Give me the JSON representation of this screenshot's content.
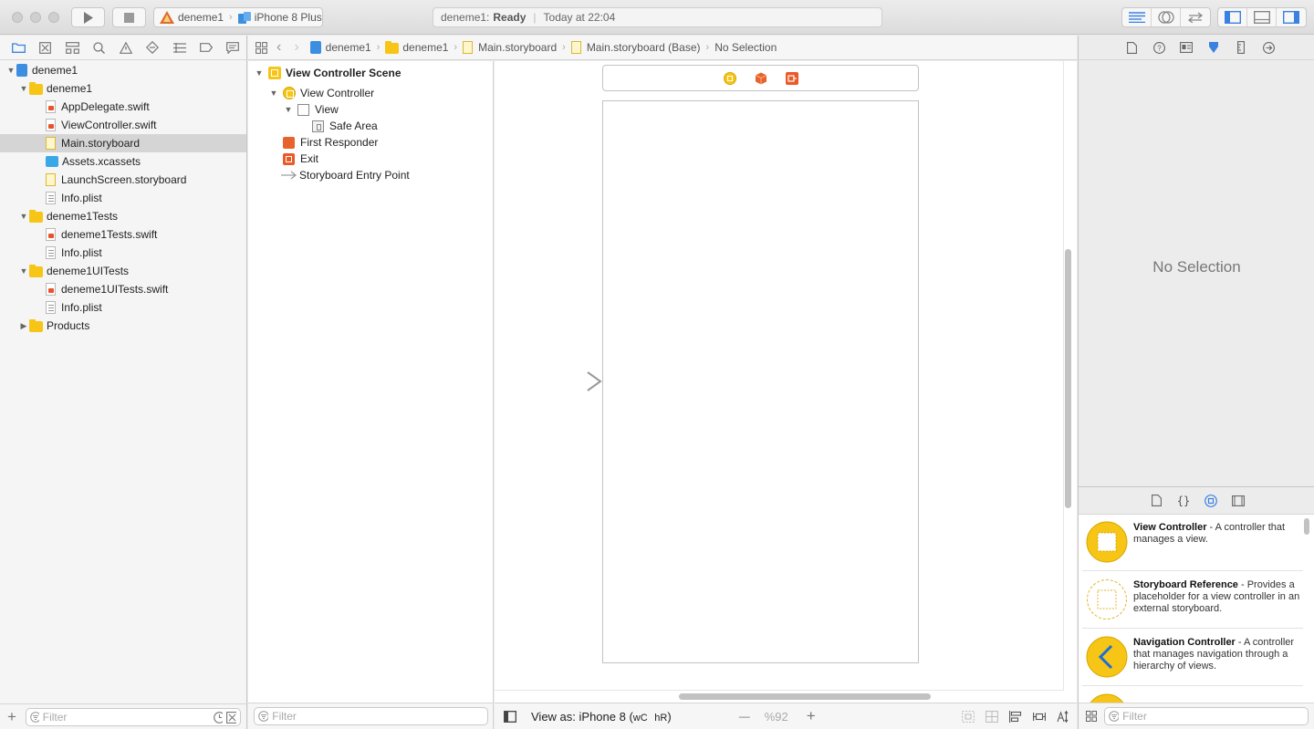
{
  "toolbar": {
    "scheme_name": "deneme1",
    "device_name": "iPhone 8 Plus",
    "activity_project": "deneme1:",
    "activity_status": "Ready",
    "activity_time": "Today at 22:04"
  },
  "navigator": {
    "tree": [
      {
        "label": "deneme1",
        "kind": "project",
        "indent": 0,
        "disclosure": "open"
      },
      {
        "label": "deneme1",
        "kind": "folder",
        "indent": 1,
        "disclosure": "open"
      },
      {
        "label": "AppDelegate.swift",
        "kind": "swift",
        "indent": 2
      },
      {
        "label": "ViewController.swift",
        "kind": "swift",
        "indent": 2
      },
      {
        "label": "Main.storyboard",
        "kind": "storyboard",
        "indent": 2,
        "selected": true
      },
      {
        "label": "Assets.xcassets",
        "kind": "assets",
        "indent": 2
      },
      {
        "label": "LaunchScreen.storyboard",
        "kind": "storyboard",
        "indent": 2
      },
      {
        "label": "Info.plist",
        "kind": "plist",
        "indent": 2
      },
      {
        "label": "deneme1Tests",
        "kind": "folder",
        "indent": 1,
        "disclosure": "open"
      },
      {
        "label": "deneme1Tests.swift",
        "kind": "swift",
        "indent": 2
      },
      {
        "label": "Info.plist",
        "kind": "plist",
        "indent": 2
      },
      {
        "label": "deneme1UITests",
        "kind": "folder",
        "indent": 1,
        "disclosure": "open"
      },
      {
        "label": "deneme1UITests.swift",
        "kind": "swift",
        "indent": 2
      },
      {
        "label": "Info.plist",
        "kind": "plist",
        "indent": 2
      },
      {
        "label": "Products",
        "kind": "folder",
        "indent": 1,
        "disclosure": "closed"
      }
    ],
    "filter_placeholder": "Filter"
  },
  "jumpbar": {
    "crumbs": [
      "deneme1",
      "deneme1",
      "Main.storyboard",
      "Main.storyboard (Base)",
      "No Selection"
    ]
  },
  "outline": {
    "scene": "View Controller Scene",
    "view_controller": "View Controller",
    "view": "View",
    "safe_area": "Safe Area",
    "first_responder": "First Responder",
    "exit": "Exit",
    "entry_point": "Storyboard Entry Point",
    "filter_placeholder": "Filter"
  },
  "canvas_bar": {
    "view_as": "View as: iPhone 8 (",
    "w_size": "wC",
    "h_size": "hR",
    "close_paren": ")",
    "zoom": "%92",
    "zoom_out": "—",
    "zoom_in": "+"
  },
  "inspector": {
    "empty_text": "No Selection"
  },
  "library": {
    "items": [
      {
        "title": "View Controller",
        "desc": " - A controller that manages a view."
      },
      {
        "title": "Storyboard Reference",
        "desc": " - Provides a placeholder for a view controller in an external storyboard."
      },
      {
        "title": "Navigation Controller",
        "desc": " - A controller that manages navigation through a hierarchy of views."
      }
    ],
    "filter_placeholder": "Filter"
  },
  "colors": {
    "accent_yellow": "#f6c516",
    "accent_orange": "#e8632b",
    "selection_gray": "#d5d5d5",
    "nav_chevron_blue": "#1a6fd6"
  }
}
